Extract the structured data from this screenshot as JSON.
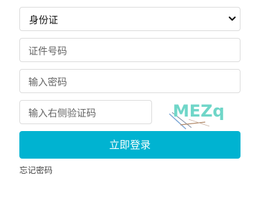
{
  "id_type": {
    "selected": "身份证"
  },
  "fields": {
    "id_number_placeholder": "证件号码",
    "password_placeholder": "输入密码",
    "captcha_placeholder": "输入右侧验证码"
  },
  "captcha": {
    "text": "MEZq",
    "color": "#6fd6c8"
  },
  "login_button": {
    "label": "立即登录",
    "color": "#00b3d1"
  },
  "forgot_link": "忘记密码"
}
